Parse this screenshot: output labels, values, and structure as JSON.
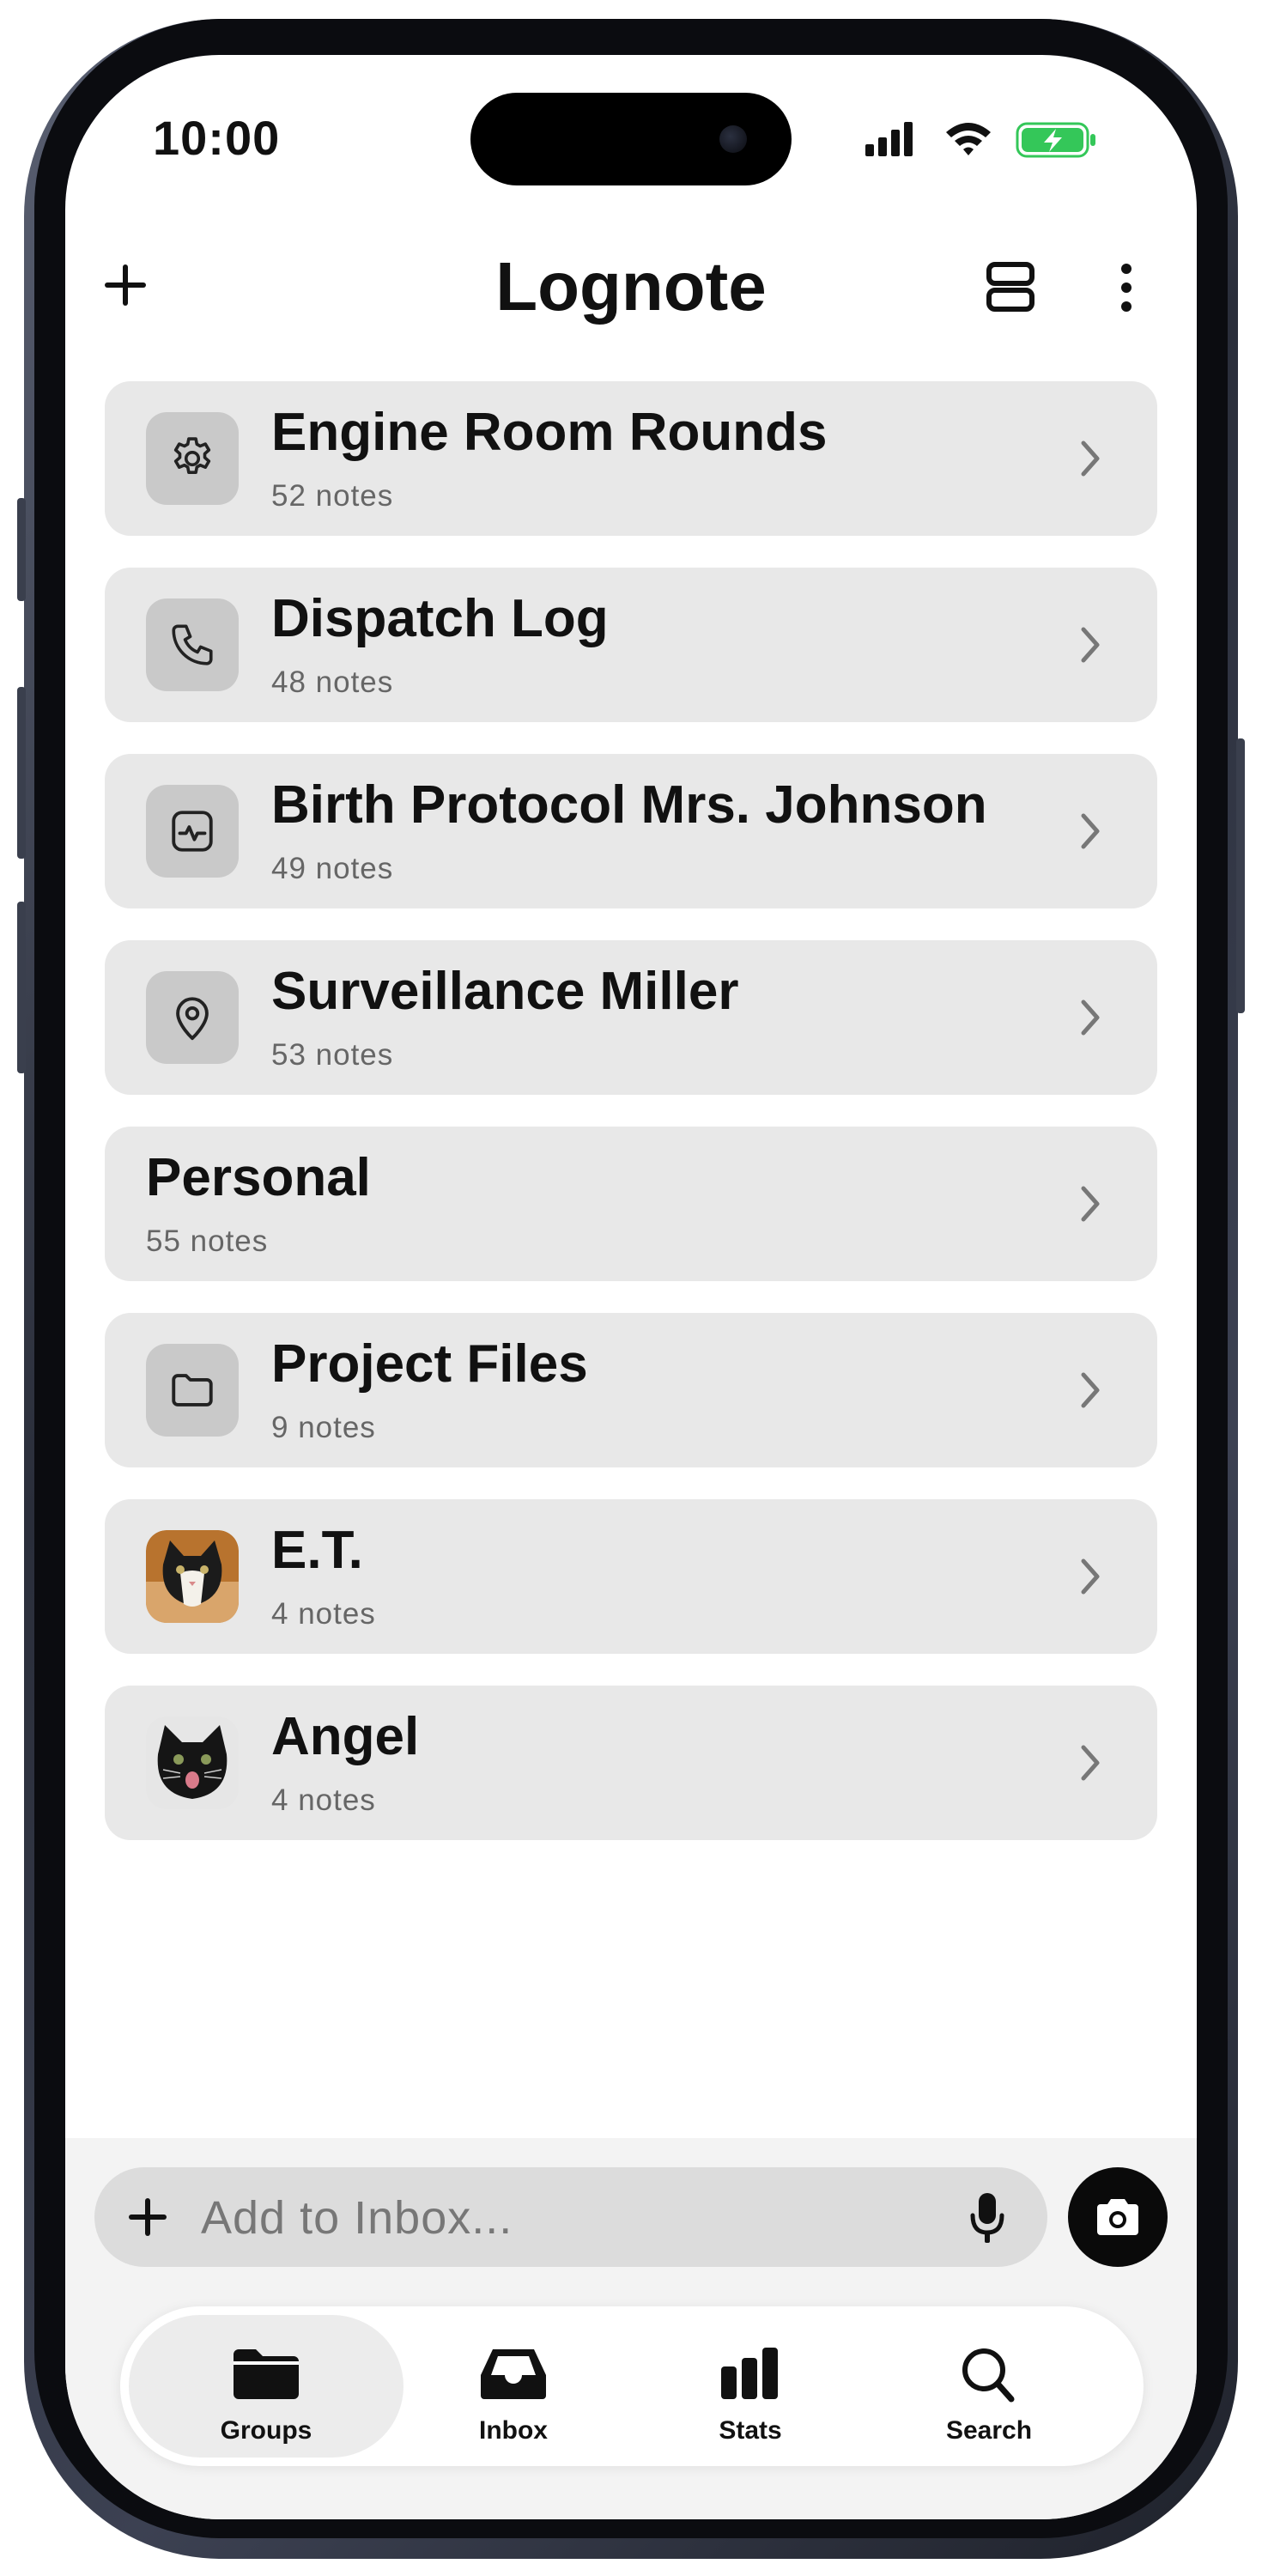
{
  "status_bar": {
    "time": "10:00"
  },
  "header": {
    "title": "Lognote",
    "add_icon": "plus-icon",
    "layout_icon": "rows-layout-icon",
    "more_icon": "more-vertical-icon"
  },
  "groups": [
    {
      "title": "Engine Room Rounds",
      "count": "52 notes",
      "icon": "gear-icon"
    },
    {
      "title": "Dispatch Log",
      "count": "48 notes",
      "icon": "phone-icon"
    },
    {
      "title": "Birth Protocol Mrs. Johnson",
      "count": "49 notes",
      "icon": "activity-icon"
    },
    {
      "title": "Surveillance Miller",
      "count": "53 notes",
      "icon": "map-pin-icon"
    },
    {
      "title": "Personal",
      "count": "55 notes",
      "icon": ""
    },
    {
      "title": "Project Files",
      "count": "9 notes",
      "icon": "folder-icon"
    },
    {
      "title": "E.T.",
      "count": "4 notes",
      "icon": "cat-photo"
    },
    {
      "title": "Angel",
      "count": "4 notes",
      "icon": "cat-photo"
    }
  ],
  "inbox": {
    "placeholder": "Add to Inbox..."
  },
  "tabs": [
    {
      "label": "Groups",
      "icon": "folder-icon",
      "active": true
    },
    {
      "label": "Inbox",
      "icon": "inbox-tray-icon",
      "active": false
    },
    {
      "label": "Stats",
      "icon": "bar-chart-icon",
      "active": false
    },
    {
      "label": "Search",
      "icon": "search-icon",
      "active": false
    }
  ],
  "colors": {
    "card_bg": "#e8e8e8",
    "icon_tile": "#c9c9c9",
    "battery_green": "#34c759"
  }
}
